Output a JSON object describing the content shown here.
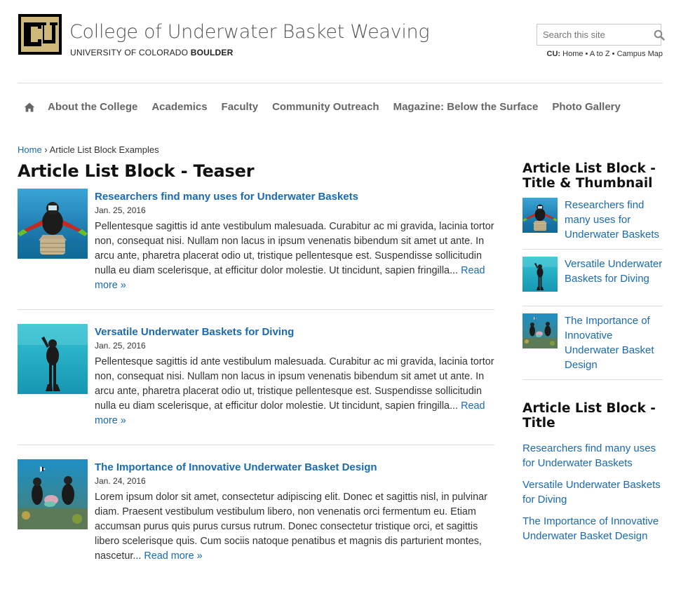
{
  "header": {
    "site_name": "College of Underwater Basket Weaving",
    "university_prefix": "UNIVERSITY OF COLORADO ",
    "university_bold": "BOULDER",
    "search_placeholder": "Search this site",
    "cu_label": "CU:",
    "cu_links": [
      "Home",
      "A to Z",
      "Campus Map"
    ],
    "separator": " • "
  },
  "nav": {
    "items": [
      "About the College",
      "Academics",
      "Faculty",
      "Community Outreach",
      "Magazine: Below the Surface",
      "Photo Gallery"
    ]
  },
  "breadcrumb": {
    "home": "Home",
    "separator": "›",
    "current": "Article List Block Examples"
  },
  "main": {
    "title": "Article List Block - Teaser",
    "read_more": "Read more »",
    "articles": [
      {
        "title": "Researchers find many uses for Underwater Baskets",
        "date": "Jan. 25, 2016",
        "summary": "Pellentesque sagittis id ante vestibulum malesuada. Curabitur ac mi gravida, lacinia tortor non, consequat nisi. Nullam non lacus in ipsum venenatis bibendum sit amet ut ante. In arcu ante, pharetra placerat odio ut, tristique pellentesque est. Suspendisse sollicitudin nulla eu diam scelerisque, at efficitur dolor molestie. Ut tincidunt, sapien fringilla..."
      },
      {
        "title": "Versatile Underwater Baskets for Diving",
        "date": "Jan. 25, 2016",
        "summary": "Pellentesque sagittis id ante vestibulum malesuada. Curabitur ac mi gravida, lacinia tortor non, consequat nisi. Nullam non lacus in ipsum venenatis bibendum sit amet ut ante. In arcu ante, pharetra placerat odio ut, tristique pellentesque est. Suspendisse sollicitudin nulla eu diam scelerisque, at efficitur dolor molestie. Ut tincidunt, sapien fringilla..."
      },
      {
        "title": "The Importance of Innovative Underwater Basket Design",
        "date": "Jan. 24, 2016",
        "summary": "Lorem ipsum dolor sit amet, consectetur adipiscing elit. Donec et sagittis nisl, in pulvinar diam. Praesent vestibulum vestibulum libero, non venenatis orci fermentum eu. Etiam accumsan purus quis purus cursus rutrum. Donec consectetur tristique orci, et sagittis libero scelerisque quis. Cum sociis natoque penatibus et magnis dis parturient montes, nascetur..."
      }
    ]
  },
  "sidebar": {
    "thumb_block_title": "Article List Block - Title & Thumbnail",
    "thumb_items": [
      "Researchers find many uses for Underwater Baskets",
      "Versatile Underwater Baskets for Diving",
      "The Importance of Innovative Underwater Basket Design"
    ],
    "title_block_title": "Article List Block - Title",
    "title_items": [
      "Researchers find many uses for Underwater Baskets",
      "Versatile Underwater Baskets for Diving",
      "The Importance of Innovative Underwater Basket Design"
    ]
  },
  "colors": {
    "link": "#1a6ab1",
    "nav_text": "#666666",
    "logo_gold": "#cfb87c",
    "logo_black": "#000000"
  }
}
